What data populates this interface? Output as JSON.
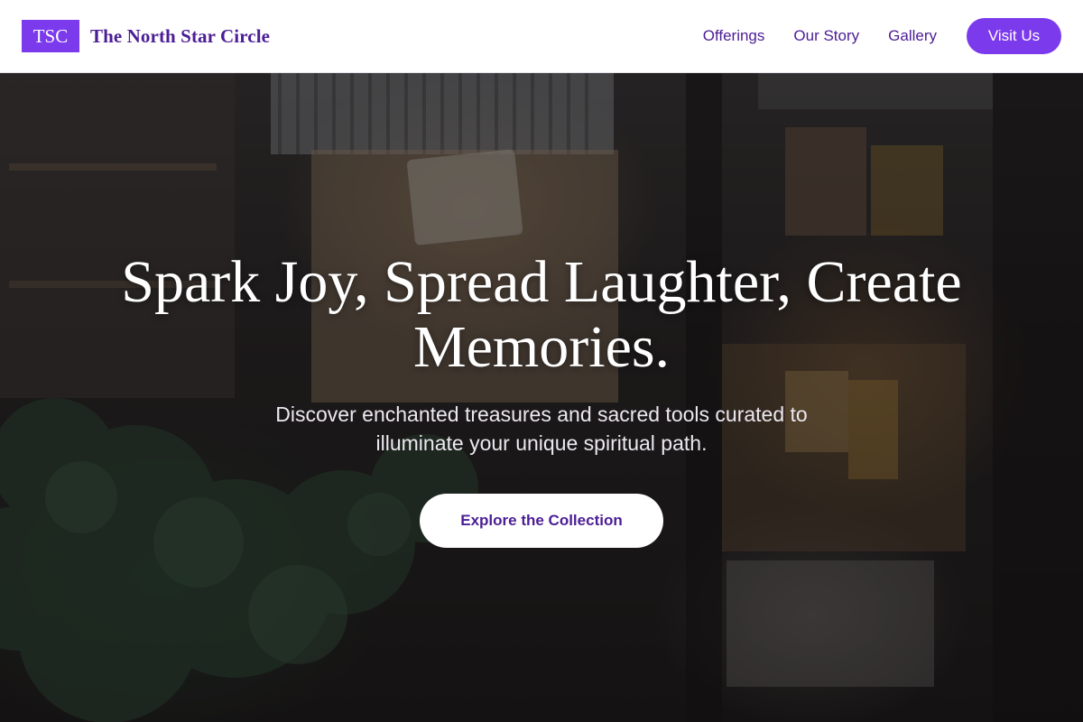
{
  "header": {
    "logo_text": "TSC",
    "brand_name": "The North Star Circle",
    "nav": [
      {
        "label": "Offerings"
      },
      {
        "label": "Our Story"
      },
      {
        "label": "Gallery"
      }
    ],
    "cta_label": "Visit Us"
  },
  "hero": {
    "headline": "Spark Joy, Spread Laughter, Create Memories.",
    "subtitle": "Discover enchanted treasures and sacred tools curated to illuminate your unique spiritual path.",
    "cta_label": "Explore the Collection",
    "background": "photo-storefront-night"
  },
  "colors": {
    "accent": "#7c3aed",
    "brand_text": "#4c1d95",
    "header_bg": "#ffffff",
    "hero_text": "#ffffff"
  }
}
